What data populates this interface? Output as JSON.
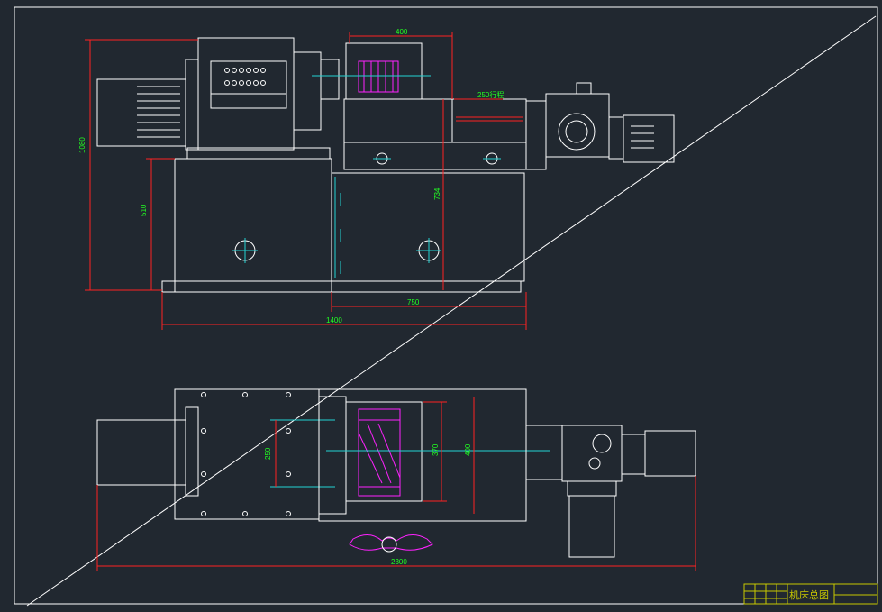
{
  "drawing": {
    "title_block": {
      "title": "机床总图"
    },
    "dimensions": {
      "front_top_width": "400",
      "front_overall_height": "1080",
      "front_base_height": "510",
      "front_right_height": "734",
      "front_stroke": "250行程",
      "front_right_width": "750",
      "front_overall_width": "1400",
      "top_center_distance": "250",
      "top_inner_width": "370",
      "top_outer_width": "400",
      "top_overall_length": "2300"
    },
    "colors": {
      "background": "#212830",
      "outline": "#ffffff",
      "dimension": "#ff2222",
      "dimension_text": "#22ff22",
      "center_line": "#22d3d3",
      "hatch": "#ff22ff",
      "title_block": "#c8c800"
    }
  }
}
